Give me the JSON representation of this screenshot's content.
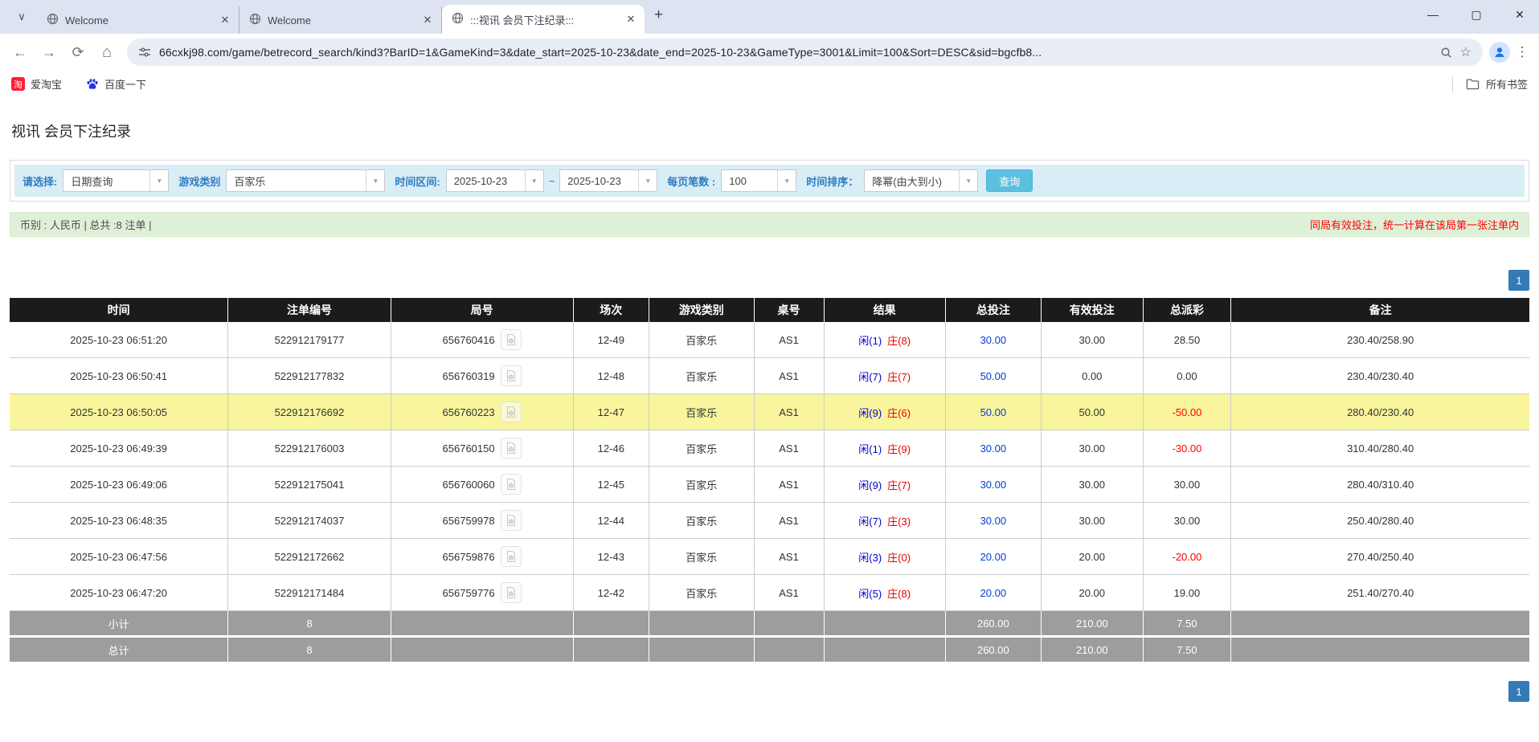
{
  "browser": {
    "tabs": [
      {
        "title": "Welcome"
      },
      {
        "title": "Welcome"
      },
      {
        "title": ":::视讯 会员下注纪录:::"
      }
    ],
    "new_tab_label": "+",
    "window_controls": {
      "minimize": "—",
      "maximize": "▢",
      "close": "✕"
    },
    "url": "66cxkj98.com/game/betrecord_search/kind3?BarID=1&GameKind=3&date_start=2025-10-23&date_end=2025-10-23&GameType=3001&Limit=100&Sort=DESC&sid=bgcfb8...",
    "bookmarks": [
      {
        "label": "爱淘宝",
        "icon": "taobao-icon"
      },
      {
        "label": "百度一下",
        "icon": "baidu-paw-icon"
      }
    ],
    "all_bookmarks_label": "所有书签"
  },
  "page": {
    "title": "视讯 会员下注纪录",
    "filters": {
      "select_label": "请选择:",
      "select_value": "日期查询",
      "game_type_label": "游戏类别",
      "game_type_value": "百家乐",
      "date_range_label": "时间区间:",
      "date_start": "2025-10-23",
      "date_separator": "~",
      "date_end": "2025-10-23",
      "page_size_label": "每页笔数 :",
      "page_size_value": "100",
      "sort_label": "时间排序：",
      "sort_value": "降幂(由大到小)",
      "search_button": "查询"
    },
    "summary_bar": {
      "left": "币别 : 人民币 | 总共 :8 注单 |",
      "right": "同局有效投注，统一计算在该局第一张注单内"
    },
    "pagination": {
      "current": "1"
    }
  },
  "table": {
    "headers": [
      "时间",
      "注单编号",
      "局号",
      "场次",
      "游戏类别",
      "桌号",
      "结果",
      "总投注",
      "有效投注",
      "总派彩",
      "备注"
    ],
    "rows": [
      {
        "time": "2025-10-23 06:51:20",
        "bet_id": "522912179177",
        "game_no": "656760416",
        "round": "12-49",
        "game_type": "百家乐",
        "table_no": "AS1",
        "result_player": "闲(1)",
        "result_banker": "庄(8)",
        "total_bet": "30.00",
        "valid_bet": "30.00",
        "payout": "28.50",
        "remark": "230.40/258.90",
        "highlighted": false
      },
      {
        "time": "2025-10-23 06:50:41",
        "bet_id": "522912177832",
        "game_no": "656760319",
        "round": "12-48",
        "game_type": "百家乐",
        "table_no": "AS1",
        "result_player": "闲(7)",
        "result_banker": "庄(7)",
        "total_bet": "50.00",
        "valid_bet": "0.00",
        "payout": "0.00",
        "remark": "230.40/230.40",
        "highlighted": false
      },
      {
        "time": "2025-10-23 06:50:05",
        "bet_id": "522912176692",
        "game_no": "656760223",
        "round": "12-47",
        "game_type": "百家乐",
        "table_no": "AS1",
        "result_player": "闲(9)",
        "result_banker": "庄(6)",
        "total_bet": "50.00",
        "valid_bet": "50.00",
        "payout": "-50.00",
        "remark": "280.40/230.40",
        "highlighted": true
      },
      {
        "time": "2025-10-23 06:49:39",
        "bet_id": "522912176003",
        "game_no": "656760150",
        "round": "12-46",
        "game_type": "百家乐",
        "table_no": "AS1",
        "result_player": "闲(1)",
        "result_banker": "庄(9)",
        "total_bet": "30.00",
        "valid_bet": "30.00",
        "payout": "-30.00",
        "remark": "310.40/280.40",
        "highlighted": false
      },
      {
        "time": "2025-10-23 06:49:06",
        "bet_id": "522912175041",
        "game_no": "656760060",
        "round": "12-45",
        "game_type": "百家乐",
        "table_no": "AS1",
        "result_player": "闲(9)",
        "result_banker": "庄(7)",
        "total_bet": "30.00",
        "valid_bet": "30.00",
        "payout": "30.00",
        "remark": "280.40/310.40",
        "highlighted": false
      },
      {
        "time": "2025-10-23 06:48:35",
        "bet_id": "522912174037",
        "game_no": "656759978",
        "round": "12-44",
        "game_type": "百家乐",
        "table_no": "AS1",
        "result_player": "闲(7)",
        "result_banker": "庄(3)",
        "total_bet": "30.00",
        "valid_bet": "30.00",
        "payout": "30.00",
        "remark": "250.40/280.40",
        "highlighted": false
      },
      {
        "time": "2025-10-23 06:47:56",
        "bet_id": "522912172662",
        "game_no": "656759876",
        "round": "12-43",
        "game_type": "百家乐",
        "table_no": "AS1",
        "result_player": "闲(3)",
        "result_banker": "庄(0)",
        "total_bet": "20.00",
        "valid_bet": "20.00",
        "payout": "-20.00",
        "remark": "270.40/250.40",
        "highlighted": false
      },
      {
        "time": "2025-10-23 06:47:20",
        "bet_id": "522912171484",
        "game_no": "656759776",
        "round": "12-42",
        "game_type": "百家乐",
        "table_no": "AS1",
        "result_player": "闲(5)",
        "result_banker": "庄(8)",
        "total_bet": "20.00",
        "valid_bet": "20.00",
        "payout": "19.00",
        "remark": "251.40/270.40",
        "highlighted": false
      }
    ],
    "subtotal": {
      "label": "小计",
      "count": "8",
      "total_bet": "260.00",
      "valid_bet": "210.00",
      "payout": "7.50"
    },
    "total": {
      "label": "总计",
      "count": "8",
      "total_bet": "260.00",
      "valid_bet": "210.00",
      "payout": "7.50"
    }
  },
  "colors": {
    "filter_bar_bg": "#d9edf7",
    "search_button_bg": "#5bc0de",
    "summary_bar_bg": "#dff0d8",
    "notice_red": "#ff0000",
    "table_header_bg": "#1b1b1b",
    "highlight_row_bg": "#f8f59d",
    "totals_row_bg": "#9d9d9d",
    "bet_link_blue": "#0040d0",
    "player_blue": "#0000d0",
    "banker_red": "#e60000",
    "pagination_active_bg": "#337ab7"
  }
}
